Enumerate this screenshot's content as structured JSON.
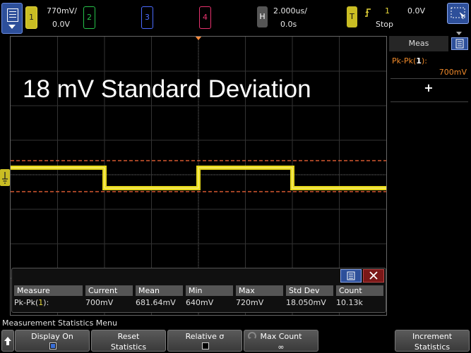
{
  "top": {
    "channels": [
      {
        "num": "1",
        "scale": "770mV/",
        "offset": "0.0V",
        "color": "#e8d83a"
      },
      {
        "num": "2",
        "color": "#26c24a"
      },
      {
        "num": "3",
        "color": "#4b6bff"
      },
      {
        "num": "4",
        "color": "#e8326e"
      }
    ],
    "horizontal": {
      "label": "H",
      "timebase": "2.000us/",
      "delay": "0.0s"
    },
    "trigger": {
      "label": "T",
      "slope_icon": "rising-edge-icon",
      "source": "1",
      "level": "0.0V",
      "mode": "Stop"
    }
  },
  "screen": {
    "annotation": "18 mV Standard Deviation",
    "trace_color": "#f2e41a",
    "cursor_color": "#ff6a3a",
    "ground_marker": "1"
  },
  "side_panel": {
    "tab": "Meas",
    "measurement_name": "Pk-Pk(",
    "measurement_channel": "1",
    "measurement_close": "):",
    "measurement_value": "700mV",
    "add_label": "+"
  },
  "stats": {
    "headers": [
      "Measure",
      "Current",
      "Mean",
      "Min",
      "Max",
      "Std Dev",
      "Count"
    ],
    "row": {
      "measure_prefix": "Pk-Pk(",
      "measure_ch": "1",
      "measure_suffix": "):",
      "current": "700mV",
      "mean": "681.64mV",
      "min": "640mV",
      "max": "720mV",
      "std_dev": "18.050mV",
      "count": "10.13k"
    }
  },
  "bottom": {
    "menu_title": "Measurement Statistics Menu",
    "keys": [
      {
        "line1": "Display On",
        "line2": ""
      },
      {
        "line1": "Reset",
        "line2": "Statistics"
      },
      {
        "line1": "Relative σ",
        "line2": ""
      },
      {
        "line1": "Max Count",
        "line2": "∞"
      },
      {
        "line1": "Increment",
        "line2": "Statistics"
      }
    ]
  }
}
